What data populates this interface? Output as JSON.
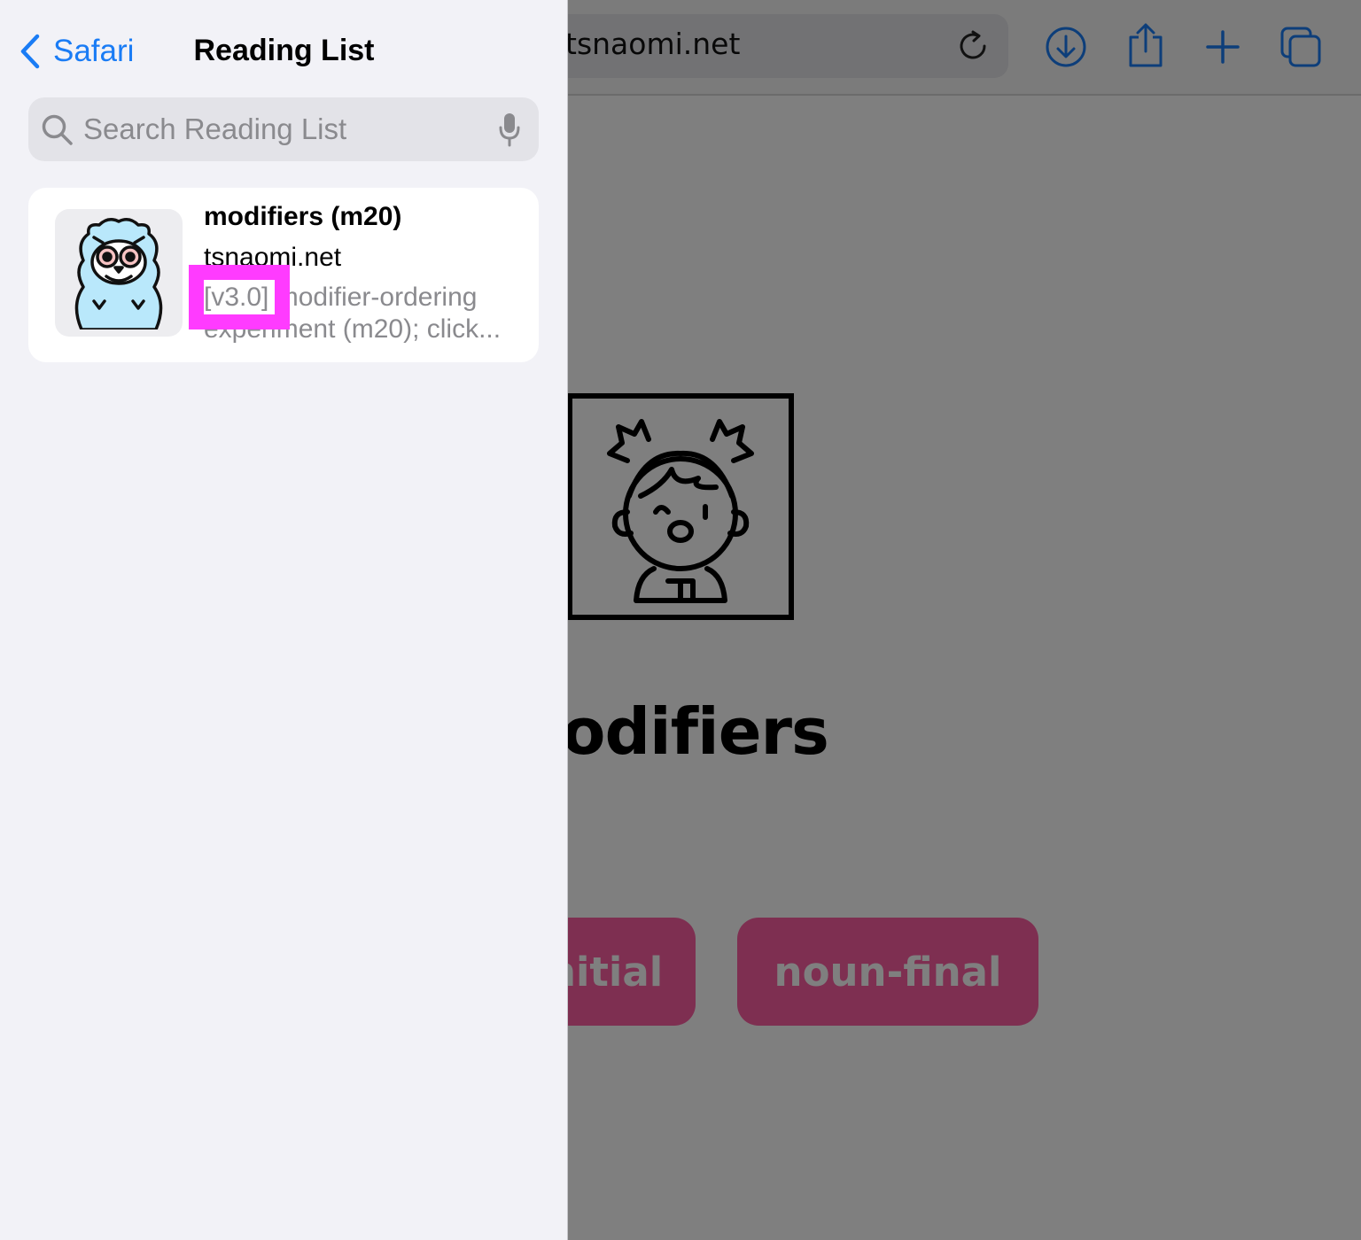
{
  "browser": {
    "address": "tsnaomi.net",
    "toolbar_icons": [
      "reload-icon",
      "download-icon",
      "share-icon",
      "add-tab-icon",
      "tabs-icon"
    ]
  },
  "page": {
    "heading": "modifiers",
    "buttons": [
      {
        "label": "noun-initial"
      },
      {
        "label": "noun-final"
      }
    ],
    "button_color": "#fd5fa2",
    "image_icon": "girl-with-pigtails-icon"
  },
  "sidebar": {
    "back_label": "Safari",
    "title": "Reading List",
    "search": {
      "placeholder": "Search Reading List",
      "value": ""
    },
    "items": [
      {
        "title": "modifiers (m20)",
        "domain": "tsnaomi.net",
        "description": "[v3.0] modifier-ordering experiment (m20); click...",
        "thumbnail_icon": "yeti-icon"
      }
    ]
  },
  "colors": {
    "accent": "#1a7cf5",
    "highlight": "#ff3bff",
    "sidebar_bg": "#f2f2f7"
  }
}
